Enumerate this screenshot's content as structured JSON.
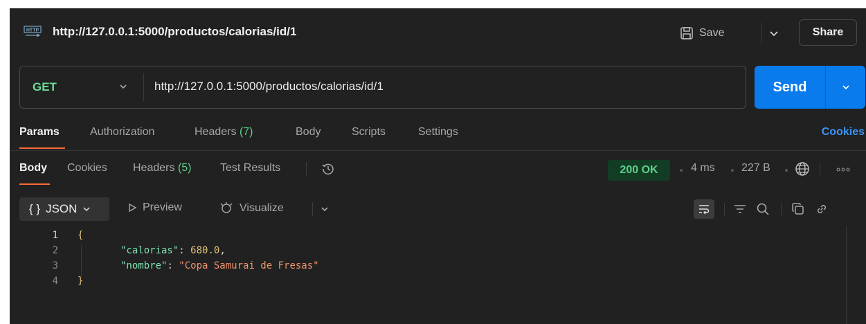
{
  "request": {
    "title": "http://127.0.0.1:5000/productos/calorias/id/1",
    "save_label": "Save",
    "share_label": "Share",
    "method": "GET",
    "url": "http://127.0.0.1:5000/productos/calorias/id/1",
    "send_label": "Send"
  },
  "request_tabs": {
    "params": "Params",
    "authorization": "Authorization",
    "headers": "Headers",
    "headers_count": "(7)",
    "body": "Body",
    "scripts": "Scripts",
    "settings": "Settings",
    "cookies": "Cookies"
  },
  "response_tabs": {
    "body": "Body",
    "cookies": "Cookies",
    "headers": "Headers",
    "headers_count": "(5)",
    "test_results": "Test Results"
  },
  "response_meta": {
    "status": "200 OK",
    "time": "4 ms",
    "size": "227 B"
  },
  "toolbar": {
    "format_icon": "{ }",
    "format_label": "JSON",
    "preview_label": "Preview",
    "visualize_label": "Visualize"
  },
  "code_lines": [
    {
      "num": "1",
      "text": "{"
    },
    {
      "num": "2",
      "key": "\"calorias\"",
      "sep": ": ",
      "value": "680.0",
      "end": ","
    },
    {
      "num": "3",
      "key": "\"nombre\"",
      "sep": ": ",
      "value": "\"Copa Samurai de Fresas\"",
      "end": ""
    },
    {
      "num": "4",
      "text": "}"
    }
  ],
  "icons": {
    "http": "http-request-icon",
    "save": "save-icon",
    "history": "history-icon",
    "globe": "globe-icon",
    "more": "more-icon",
    "wrap": "wrap-lines-icon",
    "filter": "filter-icon",
    "search": "search-icon",
    "copy": "copy-icon",
    "link": "link-icon"
  },
  "colors": {
    "accent_send": "#097bed",
    "status_green": "#5fd08b",
    "tab_underline": "#ff6c37",
    "link_blue": "#3d93f5"
  }
}
